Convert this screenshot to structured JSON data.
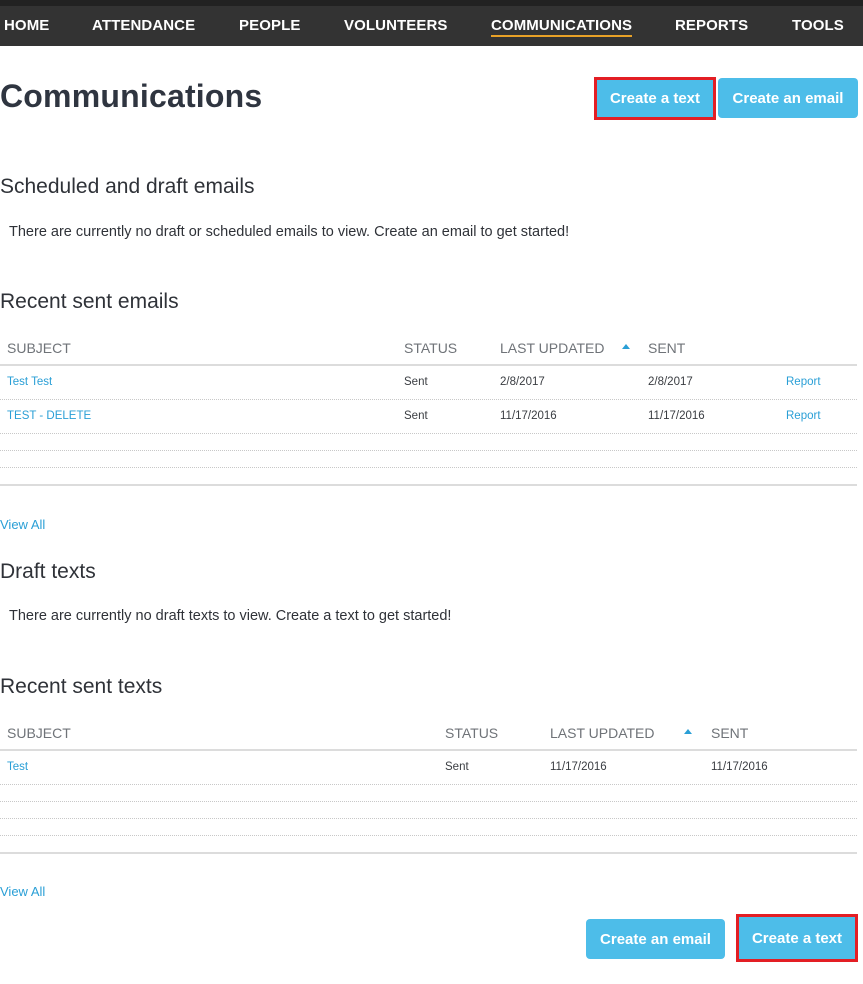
{
  "nav": {
    "items": [
      {
        "label": "HOME",
        "active": false
      },
      {
        "label": "ATTENDANCE",
        "active": false
      },
      {
        "label": "PEOPLE",
        "active": false
      },
      {
        "label": "VOLUNTEERS",
        "active": false
      },
      {
        "label": "COMMUNICATIONS",
        "active": true
      },
      {
        "label": "REPORTS",
        "active": false
      },
      {
        "label": "TOOLS",
        "active": false
      }
    ],
    "active_underline_color": "#e8a127"
  },
  "header": {
    "title": "Communications",
    "create_text_label": "Create a text",
    "create_email_label": "Create an email"
  },
  "scheduled_emails": {
    "title": "Scheduled and draft emails",
    "empty_message": "There are currently no draft or scheduled emails to view. Create an email to get started!"
  },
  "sent_emails": {
    "title": "Recent sent emails",
    "columns": [
      "SUBJECT",
      "STATUS",
      "LAST UPDATED",
      "SENT"
    ],
    "sort_icon": "sort-ascending-icon",
    "rows": [
      {
        "subject": "Test Test",
        "status": "Sent",
        "last_updated": "2/8/2017",
        "sent": "2/8/2017",
        "action": "Report"
      },
      {
        "subject": "TEST - DELETE",
        "status": "Sent",
        "last_updated": "11/17/2016",
        "sent": "11/17/2016",
        "action": "Report"
      }
    ],
    "view_all": "View All"
  },
  "draft_texts": {
    "title": "Draft texts",
    "empty_message": "There are currently no draft texts to view. Create a text to get started!"
  },
  "sent_texts": {
    "title": "Recent sent texts",
    "columns": [
      "SUBJECT",
      "STATUS",
      "LAST UPDATED",
      "SENT"
    ],
    "sort_icon": "sort-ascending-icon",
    "rows": [
      {
        "subject": "Test",
        "status": "Sent",
        "last_updated": "11/17/2016",
        "sent": "11/17/2016"
      }
    ],
    "view_all": "View All"
  },
  "footer": {
    "create_email_label": "Create an email",
    "create_text_label": "Create a text"
  },
  "colors": {
    "nav_bg": "#333333",
    "button_bg": "#4dbde9",
    "highlight_border": "#e31e24",
    "link": "#2a9fd6"
  }
}
